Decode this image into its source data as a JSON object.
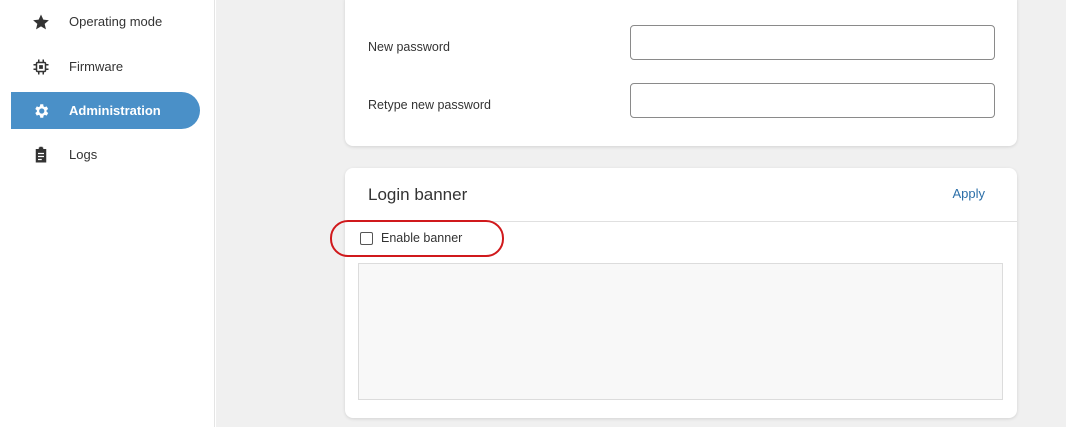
{
  "sidebar": {
    "items": [
      {
        "label": "Operating mode",
        "icon": "star-icon"
      },
      {
        "label": "Firmware",
        "icon": "chip-icon"
      },
      {
        "label": "Administration",
        "icon": "gear-icon",
        "active": true
      },
      {
        "label": "Logs",
        "icon": "clipboard-icon"
      }
    ]
  },
  "password": {
    "new_label": "New password",
    "retype_label": "Retype new password",
    "new_value": "",
    "retype_value": ""
  },
  "banner": {
    "title": "Login banner",
    "apply_label": "Apply",
    "checkbox_label": "Enable banner",
    "checkbox_checked": false,
    "text_value": ""
  },
  "colors": {
    "accent": "#4a90c8",
    "link": "#2c6fa8",
    "highlight": "#d0191c"
  }
}
